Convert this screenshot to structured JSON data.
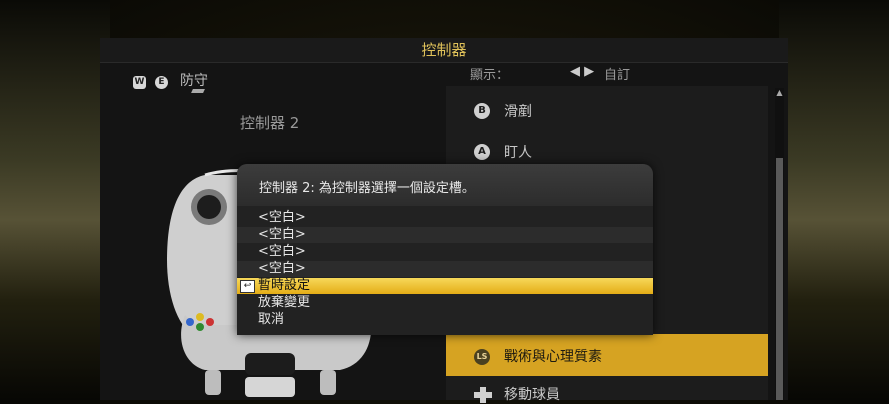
{
  "window": {
    "title": "控制器"
  },
  "left_panel": {
    "button_w": "W",
    "button_e": "E",
    "defend_label": "防守",
    "controller_label": "控制器 2"
  },
  "display": {
    "label": "顯示：",
    "arrows": "◀ ▶",
    "value": "自訂"
  },
  "actions": [
    {
      "icon": "B",
      "label": "滑剷"
    },
    {
      "icon": "A",
      "label": "盯人"
    }
  ],
  "highlighted_action": {
    "icon": "LS",
    "label": "戰術與心理質素"
  },
  "dpad_action": {
    "label": "移動球員"
  },
  "dialog": {
    "title": "控制器 2: 為控制器選擇一個設定槽。",
    "options": [
      {
        "label": "<空白>"
      },
      {
        "label": "<空白>"
      },
      {
        "label": "<空白>"
      },
      {
        "label": "<空白>"
      },
      {
        "label": "暫時設定",
        "selected": true,
        "enter_icon": "↩"
      },
      {
        "label": "放棄變更"
      },
      {
        "label": "取消"
      }
    ]
  },
  "colors": {
    "accent": "#e0c25a",
    "highlight": "#d6a322",
    "selected": "#f2c93a"
  }
}
